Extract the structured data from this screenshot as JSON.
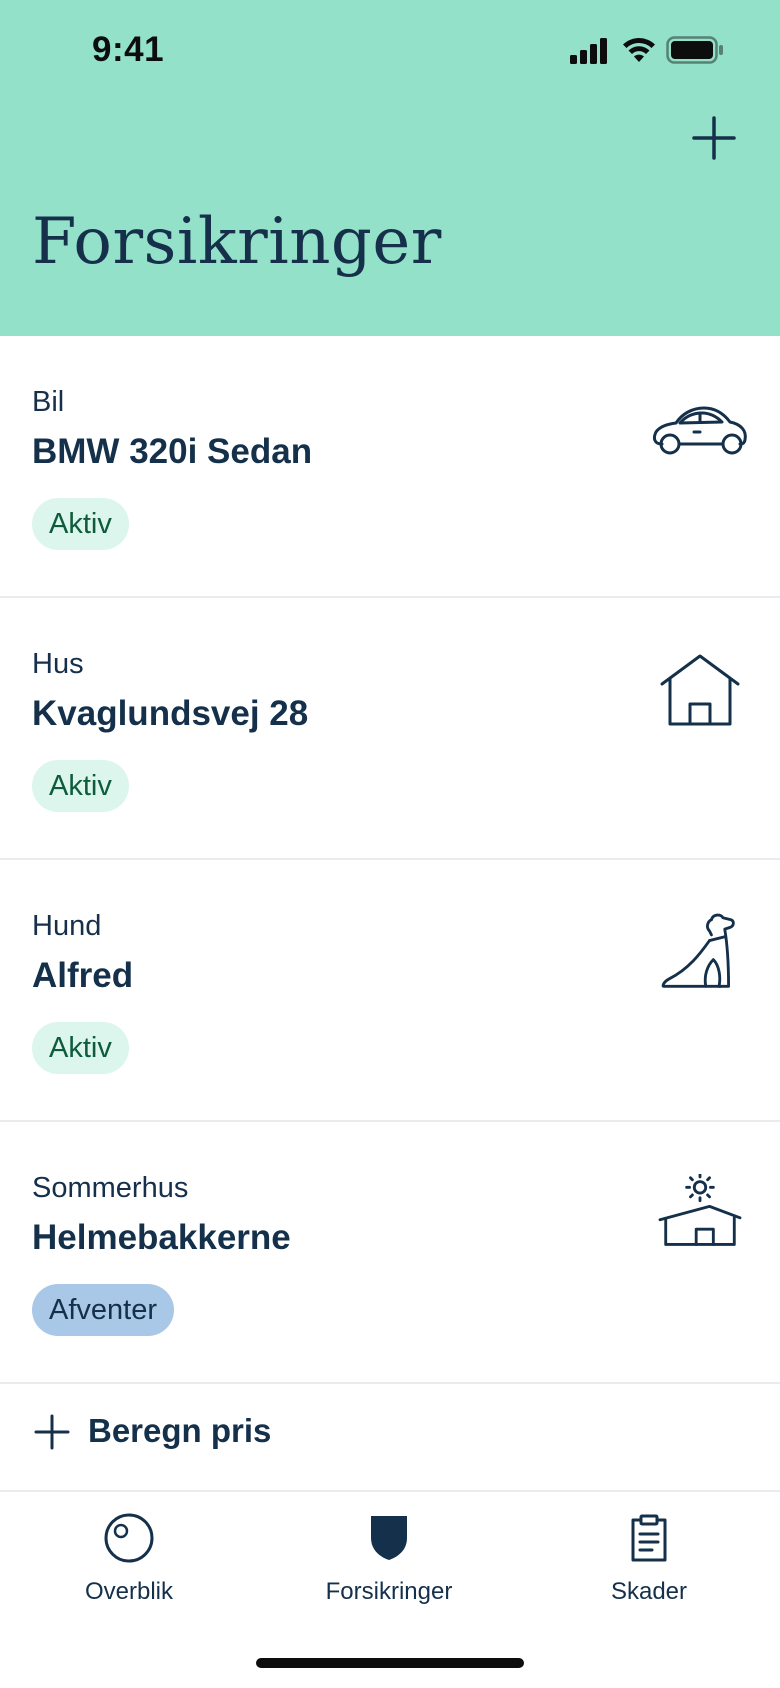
{
  "status_bar": {
    "time": "9:41"
  },
  "header": {
    "title": "Forsikringer"
  },
  "policies": [
    {
      "type": "Bil",
      "name": "BMW 320i Sedan",
      "status": "Aktiv",
      "icon": "car-icon"
    },
    {
      "type": "Hus",
      "name": "Kvaglundsvej 28",
      "status": "Aktiv",
      "icon": "house-icon"
    },
    {
      "type": "Hund",
      "name": "Alfred",
      "status": "Aktiv",
      "icon": "dog-icon"
    },
    {
      "type": "Sommerhus",
      "name": "Helmebakkerne",
      "status": "Afventer",
      "icon": "summerhouse-icon"
    }
  ],
  "calculate": {
    "label": "Beregn pris"
  },
  "tabs": [
    {
      "label": "Overblik",
      "icon": "overview-icon"
    },
    {
      "label": "Forsikringer",
      "icon": "shield-icon",
      "active": true
    },
    {
      "label": "Skader",
      "icon": "clipboard-icon"
    }
  ],
  "colors": {
    "header_bg": "#93e1c9",
    "text_primary": "#14304a",
    "badge_active_bg": "#dcf5ed",
    "badge_pending_bg": "#a9c7e6"
  }
}
